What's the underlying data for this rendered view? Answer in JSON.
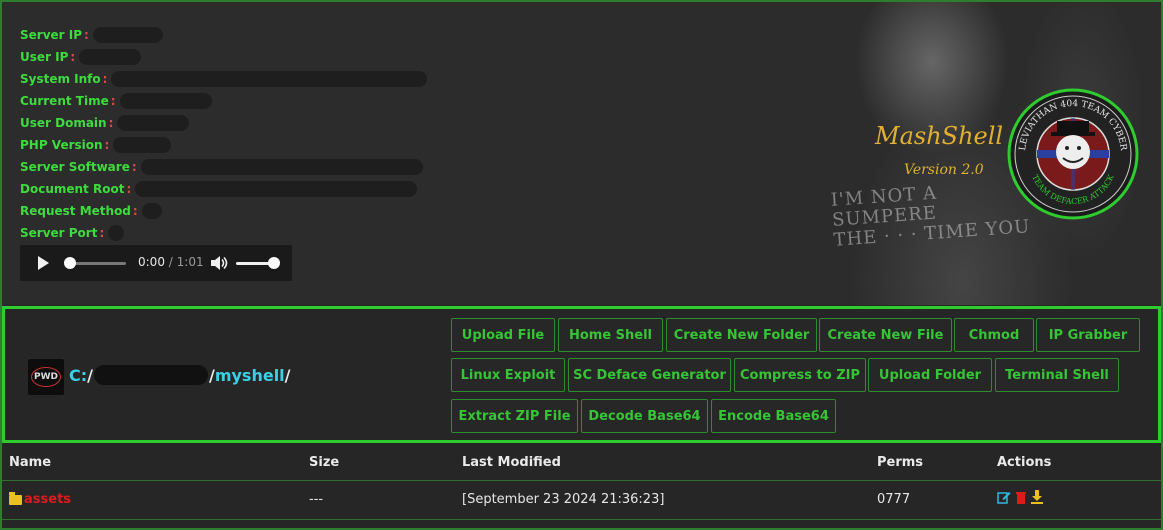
{
  "info": {
    "fields": [
      {
        "label": "Server IP"
      },
      {
        "label": "User IP"
      },
      {
        "label": "System Info"
      },
      {
        "label": "Current Time"
      },
      {
        "label": "User Domain"
      },
      {
        "label": "PHP Version"
      },
      {
        "label": "Server Software"
      },
      {
        "label": "Document Root"
      },
      {
        "label": "Request Method"
      },
      {
        "label": "Server Port"
      }
    ]
  },
  "audio": {
    "current": "0:00",
    "separator": "/",
    "duration": "1:01",
    "progress": 0,
    "volume": 1.0
  },
  "brand": {
    "name": "MashShell",
    "version": "Version 2.0",
    "logo_top": "LEVIATHAN 404 TEAM CYBER",
    "logo_bottom": "TEAM DEFACER ATTACK"
  },
  "path": {
    "badge": "PWD",
    "drive": "C:",
    "sep": "/",
    "folder": "myshell",
    "trailing": "/"
  },
  "buttons": [
    "Upload File",
    "Home Shell",
    "Create New Folder",
    "Create New File",
    "Chmod",
    "IP Grabber",
    "Linux Exploit",
    "SC Deface Generator",
    "Compress to ZIP",
    "Upload Folder",
    "Terminal Shell",
    "Extract ZIP File",
    "Decode Base64",
    "Encode Base64"
  ],
  "table": {
    "headers": {
      "name": "Name",
      "size": "Size",
      "modified": "Last Modified",
      "perms": "Perms",
      "actions": "Actions"
    },
    "rows": [
      {
        "name": "assets",
        "size": "---",
        "modified": "[September 23 2024 21:36:23]",
        "perms": "0777"
      }
    ]
  },
  "colors": {
    "accent_green": "#2ecc2e",
    "label_green": "#3ddc3d",
    "path_cyan": "#3ad1e6",
    "brand_gold": "#e0b030",
    "folder_red": "#e01a1a"
  }
}
